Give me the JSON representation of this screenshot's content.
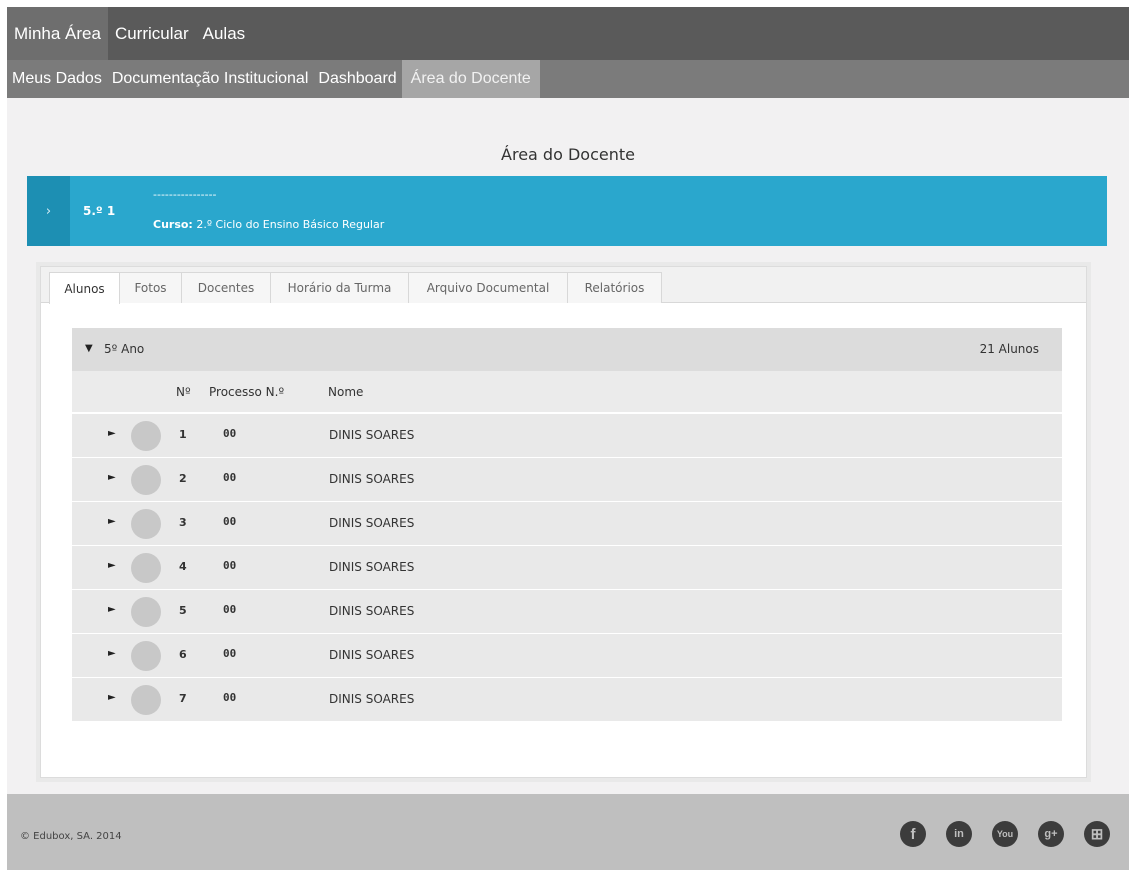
{
  "nav_primary": [
    {
      "label": "Minha Área",
      "active": true
    },
    {
      "label": "Curricular",
      "active": false
    },
    {
      "label": "Aulas",
      "active": false
    }
  ],
  "nav_secondary": [
    {
      "label": "Meus Dados",
      "active": false
    },
    {
      "label": "Documentação Institucional",
      "active": false
    },
    {
      "label": "Dashboard",
      "active": false
    },
    {
      "label": "Área do Docente",
      "active": true
    }
  ],
  "page_title": "Área do Docente",
  "class_bar": {
    "arrow": "›",
    "name": "5.º 1",
    "dashes": "----------------",
    "course_label": "Curso:",
    "course_value": "2.º Ciclo do Ensino Básico Regular",
    "color": "#2aa7cd"
  },
  "tabs": [
    {
      "label": "Alunos",
      "active": true
    },
    {
      "label": "Fotos",
      "active": false
    },
    {
      "label": "Docentes",
      "active": false
    },
    {
      "label": "Horário da Turma",
      "active": false
    },
    {
      "label": "Arquivo Documental",
      "active": false
    },
    {
      "label": "Relatórios",
      "active": false
    }
  ],
  "group": {
    "toggle": "▼",
    "label": "5º Ano",
    "count": "21 Alunos",
    "columns": {
      "n": "Nº",
      "process": "Processo N.º",
      "name": "Nome"
    },
    "rows": [
      {
        "expand": "►",
        "n": "1",
        "process": "00",
        "name": "DINIS SOARES"
      },
      {
        "expand": "►",
        "n": "2",
        "process": "00",
        "name": "DINIS SOARES"
      },
      {
        "expand": "►",
        "n": "3",
        "process": "00",
        "name": "DINIS SOARES"
      },
      {
        "expand": "►",
        "n": "4",
        "process": "00",
        "name": "DINIS SOARES"
      },
      {
        "expand": "►",
        "n": "5",
        "process": "00",
        "name": "DINIS SOARES"
      },
      {
        "expand": "►",
        "n": "6",
        "process": "00",
        "name": "DINIS SOARES"
      },
      {
        "expand": "►",
        "n": "7",
        "process": "00",
        "name": "DINIS SOARES"
      }
    ]
  },
  "footer": {
    "copyright": "© Edubox, SA. 2014",
    "social": [
      {
        "icon": "facebook-icon",
        "glyph": "f"
      },
      {
        "icon": "linkedin-icon",
        "glyph": "in"
      },
      {
        "icon": "youtube-icon",
        "glyph": "You"
      },
      {
        "icon": "google-plus-icon",
        "glyph": "g+"
      },
      {
        "icon": "edubox-icon",
        "glyph": "⊞"
      }
    ]
  }
}
